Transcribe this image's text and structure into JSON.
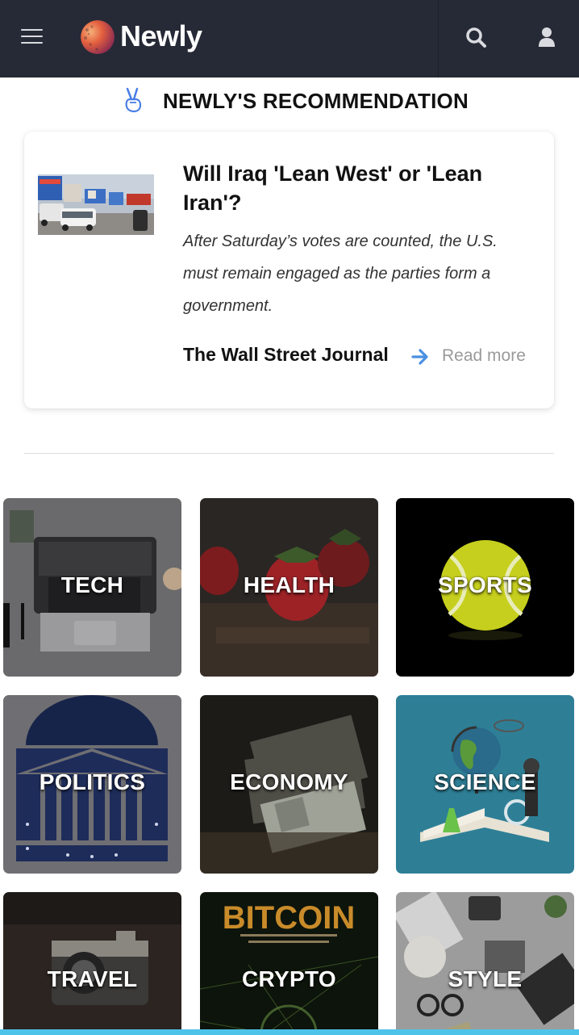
{
  "header": {
    "brand": "Newly",
    "menu_icon": "hamburger-menu-icon",
    "search_icon": "search-icon",
    "user_icon": "user-icon",
    "background": "#262a36"
  },
  "recommendation": {
    "heading": "NEWLY'S RECOMMENDATION",
    "icon": "peace-hand-icon",
    "article": {
      "title": "Will Iraq 'Lean West' or 'Lean Iran'?",
      "description": "After Saturday’s votes are counted, the U.S. must remain engaged as the parties form a government.",
      "source": "The Wall Street Journal",
      "read_more": "Read more",
      "accent": "#4a90e2"
    }
  },
  "categories": [
    {
      "label": "TECH"
    },
    {
      "label": "HEALTH"
    },
    {
      "label": "SPORTS"
    },
    {
      "label": "POLITICS"
    },
    {
      "label": "ECONOMY"
    },
    {
      "label": "SCIENCE"
    },
    {
      "label": "TRAVEL"
    },
    {
      "label": "CRYPTO",
      "image_text": "BITCOIN"
    },
    {
      "label": "STYLE"
    }
  ],
  "colors": {
    "bottom_bar": "#4ec3ea"
  }
}
